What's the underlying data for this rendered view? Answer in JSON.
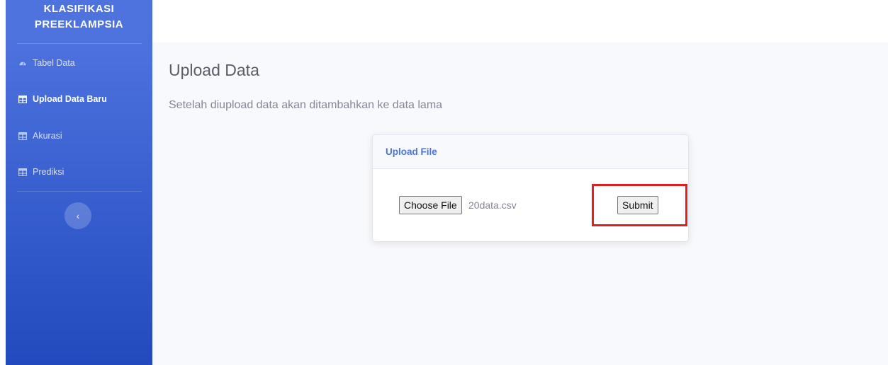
{
  "sidebar": {
    "brand_line1": "KLASIFIKASI",
    "brand_line2": "PREEKLAMPSIA",
    "items": [
      {
        "label": "Tabel Data",
        "icon": "dashboard-icon",
        "active": false
      },
      {
        "label": "Upload Data Baru",
        "icon": "table-icon",
        "active": true
      },
      {
        "label": "Akurasi",
        "icon": "table-icon",
        "active": false
      },
      {
        "label": "Prediksi",
        "icon": "table-icon",
        "active": false
      }
    ],
    "toggle_icon": "chevron-left-icon",
    "toggle_glyph": "‹"
  },
  "page": {
    "title": "Upload Data",
    "subtitle": "Setelah diupload data akan ditambahkan ke data lama"
  },
  "card": {
    "header": "Upload File",
    "choose_file_label": "Choose File",
    "file_name": "20data.csv",
    "submit_label": "Submit"
  },
  "colors": {
    "sidebar_top": "#4e73df",
    "sidebar_bottom": "#224abe",
    "accent": "#4e73df",
    "highlight": "#e02020"
  }
}
